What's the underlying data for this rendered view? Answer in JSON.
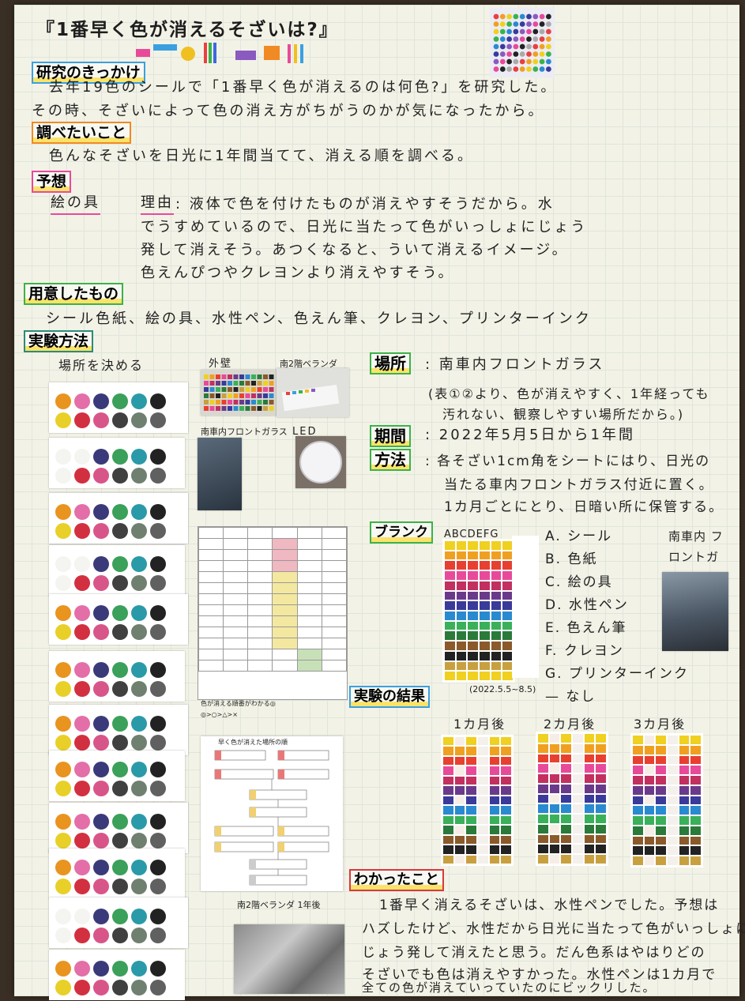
{
  "title": "『1番早く色が消えるそざいは?』",
  "sections": {
    "kikkake": {
      "heading": "研究のきっかけ",
      "lines": [
        "去年19色のシールで「1番早く色が消えるのは何色?」を研究した。",
        "その時、そざいによって色の消え方がちがうのかが気になったから。"
      ]
    },
    "shirabetai": {
      "heading": "調べたいこと",
      "lines": [
        "色んなそざいを日光に1年間当てて、消える順を調べる。"
      ]
    },
    "yosou": {
      "heading": "予想",
      "answer": "絵の具",
      "reason_label": "理由",
      "lines": [
        ": 液体で色を付けたものが消えやすそうだから。水",
        "でうすめているので、日光に当たって色がいっしょにじょう",
        "発して消えそう。あつくなると、ういて消えるイメージ。",
        "色えんぴつやクレヨンより消えやすそう。"
      ]
    },
    "youi": {
      "heading": "用意したもの",
      "lines": [
        "シール色紙、絵の具、水性ペン、色えん筆、クレヨン、プリンターインク"
      ]
    },
    "houhou": {
      "heading": "実験方法",
      "place_decide": "場所を決める",
      "photo_labels": {
        "wall": "外壁",
        "veranda": "南2階ベランダ",
        "windshield": "南車内フロントガラス",
        "led": "LED"
      },
      "sign_note": "色が消える順番がわかる◎",
      "sign_scale": "◎>○>△>×",
      "flow_title": "早く色が消えた場所の順",
      "veranda_year": "南2階ベランダ 1年後"
    },
    "place": {
      "label": "場所",
      "value": ": 南車内フロントガラス",
      "note1": "(表①②より、色が消えやすく、1年経っても",
      "note2": "汚れない、観察しやすい場所だから。)"
    },
    "period": {
      "label": "期間",
      "value": ": 2022年5月5日から1年間"
    },
    "method": {
      "label": "方法",
      "line1": ": 各そざい1cm角をシートにはり、日光の",
      "line2": "当たる車内フロントガラス付近に置く。",
      "line3": "1カ月ごとにとり、日暗い所に保管する。"
    },
    "blank": {
      "label": "ブランク",
      "columns": "ABCDEFG",
      "photo_caption": "南車内 フロントガラス",
      "legend": [
        {
          "key": "A.",
          "name": "シール"
        },
        {
          "key": "B.",
          "name": "色紙"
        },
        {
          "key": "C.",
          "name": "絵の具"
        },
        {
          "key": "D.",
          "name": "水性ペン"
        },
        {
          "key": "E.",
          "name": "色えん筆"
        },
        {
          "key": "F.",
          "name": "クレヨン"
        },
        {
          "key": "G.",
          "name": "プリンターインク"
        },
        {
          "key": "—",
          "name": "なし"
        }
      ]
    },
    "result": {
      "heading": "実験の結果",
      "date": "(2022.5.5~8.5)",
      "months": [
        "1カ月後",
        "2カ月後",
        "3カ月後"
      ]
    },
    "wakatta": {
      "heading": "わかったこと",
      "lines": [
        "1番早く消えるそざいは、水性ペンでした。予想は",
        "ハズしたけど、水性だから日光に当たって色がいっしょに",
        "じょう発して消えたと思う。だん色系はやはりどの",
        "そざいでも色は消えやすかった。水性ペンは1カ月で",
        "全ての色が消えていっていたのにビックリした。"
      ]
    }
  },
  "colors": {
    "dots": [
      "#e8941f",
      "#e46ea8",
      "#3a3a7a",
      "#3aa05a",
      "#2a9aa8",
      "#222",
      "#e8d028",
      "#d23040",
      "#d8558a",
      "#404040",
      "#708070",
      "#606060"
    ]
  }
}
